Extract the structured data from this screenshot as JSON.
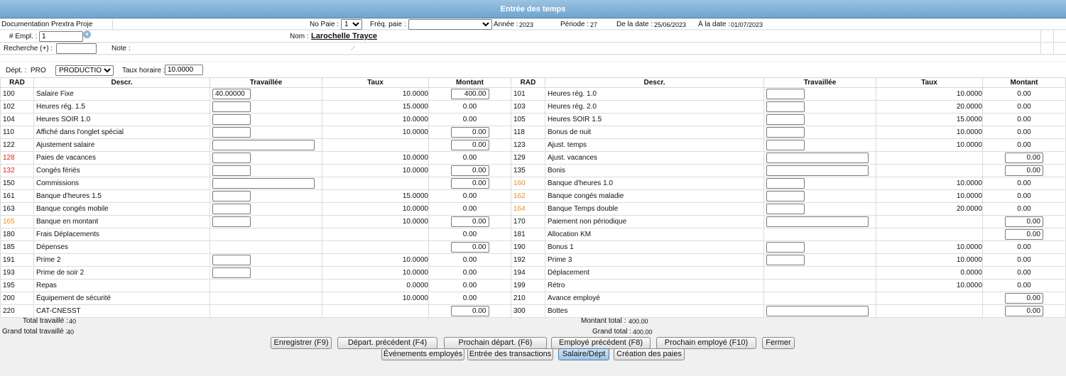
{
  "window": {
    "title": "Entrée des temps"
  },
  "header": {
    "project": "Documentation Prextra Proje",
    "no_paie_label": "No Paie :",
    "no_paie_value": "1",
    "freq_label": "Fréq. paie :",
    "freq_value": "",
    "annee_label": "Année :",
    "annee_value": "2023",
    "periode_label": "Période :",
    "periode_value": "27",
    "de_date_label": "De la date :",
    "de_date_value": "25/06/2023",
    "a_date_label": "À la date :",
    "a_date_value": "01/07/2023",
    "empl_label": "# Empl. :",
    "empl_value": "1",
    "nom_label": "Nom :",
    "nom_value": "Larochelle Trayce",
    "recherche_label": "Recherche (+) :",
    "recherche_value": "",
    "note_label": "Note :",
    "note_value": "",
    "dept_label": "Dépt. :",
    "dept_code": "PRO",
    "dept_select": "PRODUCTION",
    "taux_label": "Taux horaire :",
    "taux_value": "10.0000"
  },
  "columns": {
    "rad": "RAD",
    "descr": "Descr.",
    "travaillee": "Travaillée",
    "taux": "Taux",
    "montant": "Montant"
  },
  "rows": [
    {
      "l": {
        "rad": "100",
        "color": "",
        "descr": "Salaire Fixe",
        "trav": "input",
        "trav_value": "40.00000",
        "taux": "10.0000",
        "montant": "400.00",
        "montant_input": true
      },
      "r": {
        "rad": "101",
        "color": "",
        "descr": "Heures rég. 1.0",
        "trav": "input",
        "trav_value": "",
        "taux": "10.0000",
        "montant": "0.00",
        "montant_input": false
      }
    },
    {
      "l": {
        "rad": "102",
        "color": "",
        "descr": "Heures rég. 1.5",
        "trav": "input",
        "trav_value": "",
        "taux": "15.0000",
        "montant": "0.00",
        "montant_input": false
      },
      "r": {
        "rad": "103",
        "color": "",
        "descr": "Heures rég. 2.0",
        "trav": "input",
        "trav_value": "",
        "taux": "20.0000",
        "montant": "0.00",
        "montant_input": false
      }
    },
    {
      "l": {
        "rad": "104",
        "color": "",
        "descr": "Heures SOIR 1.0",
        "trav": "input",
        "trav_value": "",
        "taux": "10.0000",
        "montant": "0.00",
        "montant_input": false
      },
      "r": {
        "rad": "105",
        "color": "",
        "descr": "Heures SOIR 1.5",
        "trav": "input",
        "trav_value": "",
        "taux": "15.0000",
        "montant": "0.00",
        "montant_input": false
      }
    },
    {
      "l": {
        "rad": "110",
        "color": "",
        "descr": "Affiché dans l'onglet spécial",
        "trav": "input",
        "trav_value": "",
        "taux": "10.0000",
        "montant": "0.00",
        "montant_input": true
      },
      "r": {
        "rad": "118",
        "color": "",
        "descr": "Bonus de nuit",
        "trav": "input",
        "trav_value": "",
        "taux": "10.0000",
        "montant": "0.00",
        "montant_input": false
      }
    },
    {
      "l": {
        "rad": "122",
        "color": "",
        "descr": "Ajustement salaire",
        "trav": "wide",
        "trav_value": "",
        "taux": "",
        "montant": "0.00",
        "montant_input": true
      },
      "r": {
        "rad": "123",
        "color": "",
        "descr": "Ajust. temps",
        "trav": "input",
        "trav_value": "",
        "taux": "10.0000",
        "montant": "0.00",
        "montant_input": false
      }
    },
    {
      "l": {
        "rad": "128",
        "color": "red",
        "descr": "Paies de vacances",
        "trav": "input",
        "trav_value": "",
        "taux": "10.0000",
        "montant": "0.00",
        "montant_input": false
      },
      "r": {
        "rad": "129",
        "color": "",
        "descr": "Ajust. vacances",
        "trav": "wide",
        "trav_value": "",
        "taux": "",
        "montant": "0.00",
        "montant_input": true
      }
    },
    {
      "l": {
        "rad": "132",
        "color": "red",
        "descr": "Congés fériés",
        "trav": "input",
        "trav_value": "",
        "taux": "10.0000",
        "montant": "0.00",
        "montant_input": true
      },
      "r": {
        "rad": "135",
        "color": "",
        "descr": "Bonis",
        "trav": "wide",
        "trav_value": "",
        "taux": "",
        "montant": "0.00",
        "montant_input": true
      }
    },
    {
      "l": {
        "rad": "150",
        "color": "",
        "descr": "Commissions",
        "trav": "wide",
        "trav_value": "",
        "taux": "",
        "montant": "0.00",
        "montant_input": true
      },
      "r": {
        "rad": "160",
        "color": "orange",
        "descr": "Banque d'heures 1.0",
        "trav": "input",
        "trav_value": "",
        "taux": "10.0000",
        "montant": "0.00",
        "montant_input": false
      }
    },
    {
      "l": {
        "rad": "161",
        "color": "",
        "descr": "Banque d'heures 1.5",
        "trav": "input",
        "trav_value": "",
        "taux": "15.0000",
        "montant": "0.00",
        "montant_input": false
      },
      "r": {
        "rad": "162",
        "color": "orange",
        "descr": "Banque congés maladie",
        "trav": "input",
        "trav_value": "",
        "taux": "10.0000",
        "montant": "0.00",
        "montant_input": false
      }
    },
    {
      "l": {
        "rad": "163",
        "color": "",
        "descr": "Banque congés mobile",
        "trav": "input",
        "trav_value": "",
        "taux": "10.0000",
        "montant": "0.00",
        "montant_input": false
      },
      "r": {
        "rad": "164",
        "color": "orange",
        "descr": "Banque Temps double",
        "trav": "input",
        "trav_value": "",
        "taux": "20.0000",
        "montant": "0.00",
        "montant_input": false
      }
    },
    {
      "l": {
        "rad": "165",
        "color": "orange",
        "descr": "Banque en montant",
        "trav": "input",
        "trav_value": "",
        "taux": "10.0000",
        "montant": "0.00",
        "montant_input": true
      },
      "r": {
        "rad": "170",
        "color": "",
        "descr": "Paiement non périodique",
        "trav": "wide",
        "trav_value": "",
        "taux": "",
        "montant": "0.00",
        "montant_input": true
      }
    },
    {
      "l": {
        "rad": "180",
        "color": "",
        "descr": "Frais Déplacements",
        "trav": "none",
        "trav_value": "",
        "taux": "",
        "montant": "0.00",
        "montant_input": false
      },
      "r": {
        "rad": "181",
        "color": "",
        "descr": "Allocation KM",
        "trav": "none",
        "trav_value": "",
        "taux": "",
        "montant": "0.00",
        "montant_input": true
      }
    },
    {
      "l": {
        "rad": "185",
        "color": "",
        "descr": "Dépenses",
        "trav": "none",
        "trav_value": "",
        "taux": "",
        "montant": "0.00",
        "montant_input": true
      },
      "r": {
        "rad": "190",
        "color": "",
        "descr": "Bonus 1",
        "trav": "input",
        "trav_value": "",
        "taux": "10.0000",
        "montant": "0.00",
        "montant_input": false
      }
    },
    {
      "l": {
        "rad": "191",
        "color": "",
        "descr": "Prime 2",
        "trav": "input",
        "trav_value": "",
        "taux": "10.0000",
        "montant": "0.00",
        "montant_input": false
      },
      "r": {
        "rad": "192",
        "color": "",
        "descr": "Prime 3",
        "trav": "input",
        "trav_value": "",
        "taux": "10.0000",
        "montant": "0.00",
        "montant_input": false
      }
    },
    {
      "l": {
        "rad": "193",
        "color": "",
        "descr": "Prime de soir 2",
        "trav": "input",
        "trav_value": "",
        "taux": "10.0000",
        "montant": "0.00",
        "montant_input": false
      },
      "r": {
        "rad": "194",
        "color": "",
        "descr": "Déplacement",
        "trav": "none",
        "trav_value": "",
        "taux": "0.0000",
        "montant": "0.00",
        "montant_input": false
      }
    },
    {
      "l": {
        "rad": "195",
        "color": "",
        "descr": "Repas",
        "trav": "none",
        "trav_value": "",
        "taux": "0.0000",
        "montant": "0.00",
        "montant_input": false
      },
      "r": {
        "rad": "199",
        "color": "",
        "descr": "Rétro",
        "trav": "none",
        "trav_value": "",
        "taux": "10.0000",
        "montant": "0.00",
        "montant_input": false
      }
    },
    {
      "l": {
        "rad": "200",
        "color": "",
        "descr": "Équipement de sécurité",
        "trav": "none",
        "trav_value": "",
        "taux": "10.0000",
        "montant": "0.00",
        "montant_input": false
      },
      "r": {
        "rad": "210",
        "color": "",
        "descr": "Avance employé",
        "trav": "none",
        "trav_value": "",
        "taux": "",
        "montant": "0.00",
        "montant_input": true
      }
    },
    {
      "l": {
        "rad": "220",
        "color": "",
        "descr": "CAT-CNESST",
        "trav": "none",
        "trav_value": "",
        "taux": "",
        "montant": "0.00",
        "montant_input": true
      },
      "r": {
        "rad": "300",
        "color": "",
        "descr": "Bottes",
        "trav": "wide",
        "trav_value": "",
        "taux": "",
        "montant": "0.00",
        "montant_input": true
      }
    }
  ],
  "totals": {
    "total_trav_label": "Total travaillé :",
    "total_trav_value": "40",
    "grand_trav_label": "Grand total travaillé :",
    "grand_trav_value": "40",
    "montant_total_label": "Montant total :",
    "montant_total_value": "400.00",
    "grand_total_label": "Grand total :",
    "grand_total_value": "400.00"
  },
  "buttons": {
    "enregistrer": "Enregistrer (F9)",
    "depart_prec": "Départ. précédent (F4)",
    "prochain_depart": "Prochain départ. (F6)",
    "employe_prec": "Employé précédent (F8)",
    "prochain_employe": "Prochain employé (F10)",
    "fermer": "Fermer",
    "evenements": "Événements employés",
    "transactions": "Entrée des transactions",
    "salaire_dept": "Salaire/Dépt",
    "creation_paies": "Création des paies"
  }
}
